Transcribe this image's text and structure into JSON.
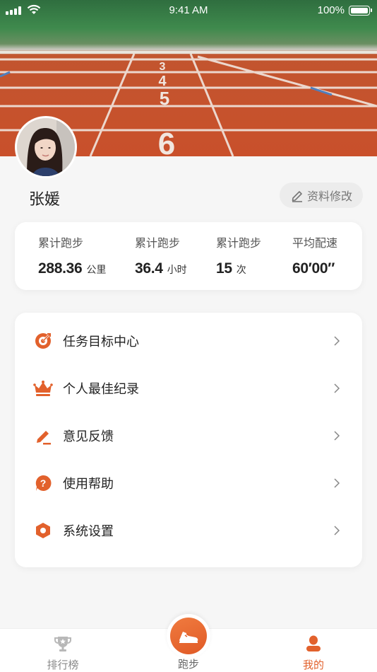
{
  "status_bar": {
    "time": "9:41 AM",
    "battery": "100%"
  },
  "profile": {
    "name": "张媛",
    "edit_label": "资料修改"
  },
  "stats": [
    {
      "label": "累计跑步",
      "value": "288.36",
      "unit": "公里"
    },
    {
      "label": "累计跑步",
      "value": "36.4",
      "unit": "小时"
    },
    {
      "label": "累计跑步",
      "value": "15",
      "unit": "次"
    },
    {
      "label": "平均配速",
      "value": "60′00″",
      "unit": ""
    }
  ],
  "menu": [
    {
      "label": "任务目标中心",
      "icon": "target-icon"
    },
    {
      "label": "个人最佳纪录",
      "icon": "crown-icon"
    },
    {
      "label": "意见反馈",
      "icon": "pencil-icon"
    },
    {
      "label": "使用帮助",
      "icon": "help-icon"
    },
    {
      "label": "系统设置",
      "icon": "settings-icon"
    }
  ],
  "tabs": {
    "ranking": "排行榜",
    "run": "跑步",
    "mine": "我的"
  },
  "colors": {
    "accent": "#e2612c",
    "track": "#c9502b",
    "grass": "#3f8a4d"
  }
}
